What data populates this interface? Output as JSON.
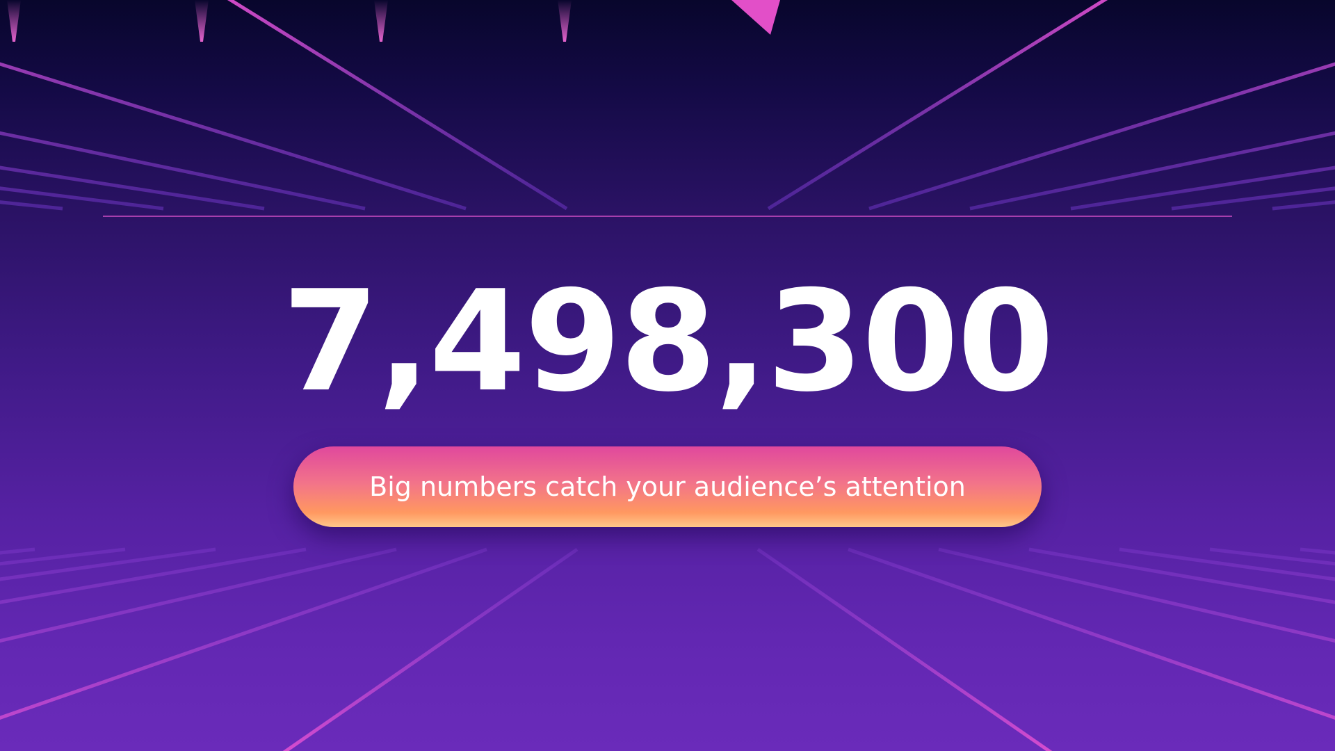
{
  "slide": {
    "number": "7,498,300",
    "caption": "Big numbers catch your audience’s attention"
  },
  "theme": {
    "grid_line_color": "#d94bd6",
    "accent_pink": "#e0489d",
    "accent_orange": "#ff9860",
    "text_color": "#ffffff"
  }
}
